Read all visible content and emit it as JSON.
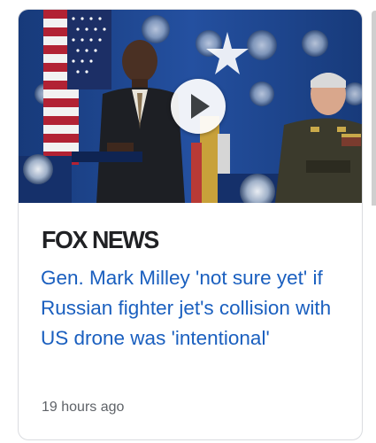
{
  "card": {
    "publisher": "FOX NEWS",
    "headline": "Gen. Mark Milley 'not sure yet' if Russian fighter jet's collision with US drone was 'intentional'",
    "timestamp": "19 hours ago"
  },
  "thumbnail": {
    "has_play_button": true,
    "icon": "play-icon"
  },
  "colors": {
    "headline": "#1a5fbf",
    "publisher": "#202124",
    "timestamp": "#5f6368",
    "card_border": "#dadce0",
    "backdrop": "#1b3f82"
  }
}
